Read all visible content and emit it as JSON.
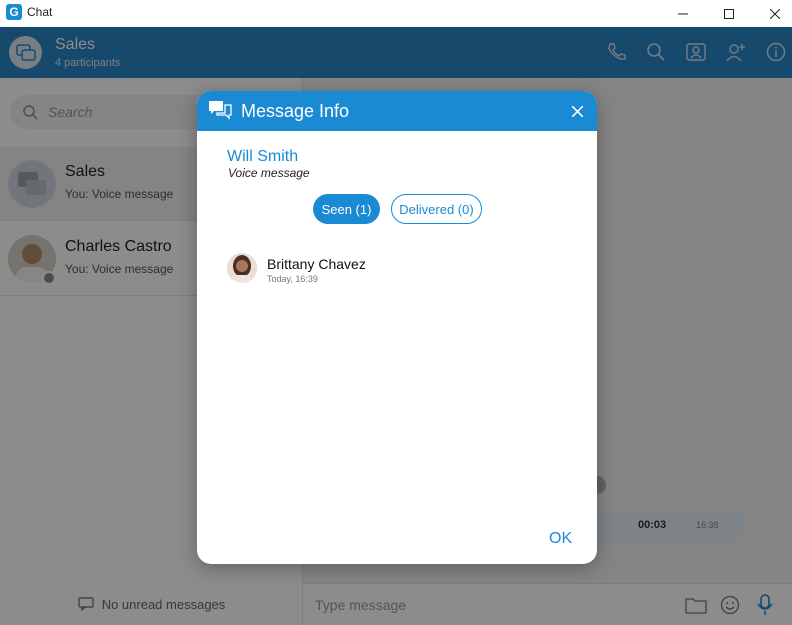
{
  "window": {
    "title": "Chat",
    "logo_letter": "G"
  },
  "header": {
    "title": "Sales",
    "subtitle": "4 participants"
  },
  "search": {
    "placeholder": "Search"
  },
  "conversations": [
    {
      "name": "Sales",
      "last_message": "You: Voice message"
    },
    {
      "name": "Charles Castro",
      "last_message": "You: Voice message"
    }
  ],
  "sidebar_footer": {
    "label": "No unread messages"
  },
  "composer": {
    "placeholder": "Type message"
  },
  "voice_message": {
    "duration": "00:03",
    "time": "16:38"
  },
  "modal": {
    "title": "Message Info",
    "sender_name": "Will Smith",
    "message_preview": "Voice message",
    "tabs": [
      {
        "label": "Seen (1)",
        "active": true
      },
      {
        "label": "Delivered (0)",
        "active": false
      }
    ],
    "viewers": [
      {
        "name": "Brittany Chavez",
        "time": "Today, 16:39"
      }
    ],
    "ok_label": "OK"
  },
  "colors": {
    "accent": "#1a8ad4",
    "header": "#2b86c5"
  }
}
